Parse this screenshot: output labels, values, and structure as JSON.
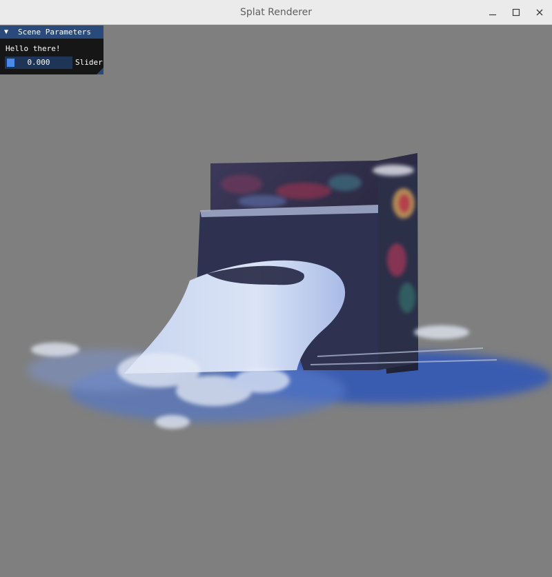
{
  "window": {
    "title": "Splat Renderer",
    "minimize_icon": "minimize-icon",
    "maximize_icon": "maximize-icon",
    "close_icon": "close-icon"
  },
  "viewport": {
    "background_color": "#7f7f7f",
    "scene_description_colors": [
      "#2f4ea8",
      "#d9e3f5",
      "#3b3050"
    ]
  },
  "panel": {
    "header": "Scene Parameters",
    "collapse_icon": "triangle-down-icon",
    "text": "Hello there!",
    "slider": {
      "value": "0.000",
      "label": "Slider",
      "fraction": 0.0
    },
    "header_color": "#294a7a",
    "accent_color": "#4a8ae8"
  }
}
